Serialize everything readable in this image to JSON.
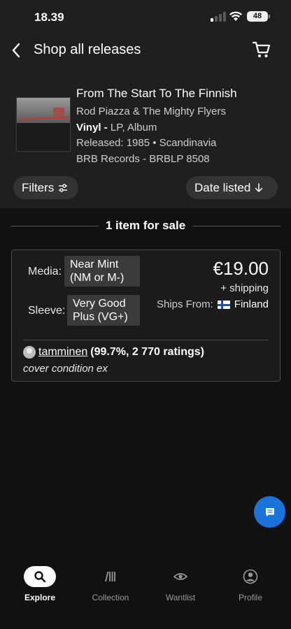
{
  "status_bar": {
    "time": "18.39",
    "battery": "48"
  },
  "header": {
    "title": "Shop all releases"
  },
  "release": {
    "title": "From The Start To The Finnish",
    "artist": "Rod Piazza & The Mighty Flyers",
    "format_label": "Vinyl -",
    "format_value": "LP, Album",
    "released": "Released: 1985 • Scandinavia",
    "label_catno": "BRB Records - BRBLP 8508"
  },
  "controls": {
    "filters_label": "Filters",
    "sort_label": "Date listed"
  },
  "results": {
    "count_text": "1 item for sale"
  },
  "listing": {
    "media_label": "Media:",
    "media_condition": "Near Mint (NM or M-)",
    "sleeve_label": "Sleeve:",
    "sleeve_condition": "Very Good Plus (VG+)",
    "price": "€19.00",
    "shipping": "+  shipping",
    "ships_from_label": "Ships From:",
    "ships_from_country": "Finland",
    "seller_name": "tamminen",
    "seller_rating": "(99.7%, 2 770 ratings)",
    "comment": "cover condition ex"
  },
  "bottom_nav": {
    "items": [
      {
        "label": "Explore",
        "icon": "search-icon",
        "active": true
      },
      {
        "label": "Collection",
        "icon": "collection-icon",
        "active": false
      },
      {
        "label": "Wantlist",
        "icon": "eye-icon",
        "active": false
      },
      {
        "label": "Profile",
        "icon": "profile-icon",
        "active": false
      }
    ]
  },
  "colors": {
    "accent": "#1a73d9",
    "background": "#111111",
    "surface": "#1f1f1f"
  }
}
